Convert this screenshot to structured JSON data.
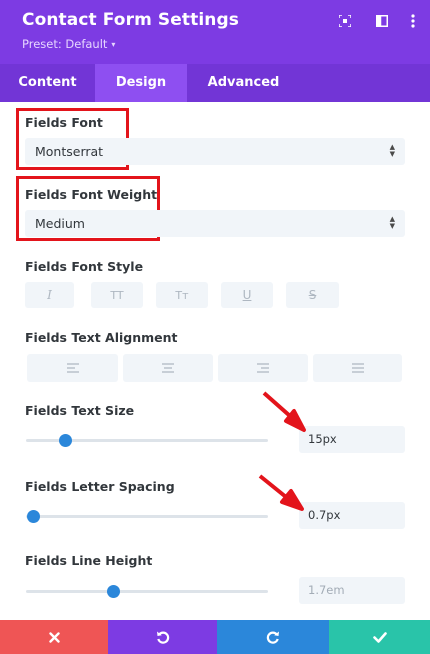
{
  "header": {
    "title": "Contact Form Settings",
    "preset": "Preset: Default",
    "icons": [
      "focus-icon",
      "split-layout-icon",
      "more-vertical-icon"
    ]
  },
  "tabs": [
    {
      "label": "Content",
      "active": false
    },
    {
      "label": "Design",
      "active": true
    },
    {
      "label": "Advanced",
      "active": false
    }
  ],
  "fields_font": {
    "label": "Fields Font",
    "value": "Montserrat"
  },
  "fields_font_weight": {
    "label": "Fields Font Weight",
    "value": "Medium"
  },
  "fields_font_style": {
    "label": "Fields Font Style",
    "options": [
      {
        "glyph": "I",
        "icon": "italic-icon"
      },
      {
        "glyph": "TT",
        "icon": "uppercase-icon"
      },
      {
        "glyph": "Tт",
        "icon": "capitalize-icon"
      },
      {
        "glyph": "U",
        "icon": "underline-icon"
      },
      {
        "glyph": "S",
        "icon": "strikethrough-icon"
      }
    ]
  },
  "fields_text_alignment": {
    "label": "Fields Text Alignment",
    "options": [
      "align-left-icon",
      "align-center-icon",
      "align-right-icon",
      "align-justify-icon"
    ]
  },
  "fields_text_size": {
    "label": "Fields Text Size",
    "value": "15px",
    "slider_fraction": 0.16
  },
  "fields_letter_spacing": {
    "label": "Fields Letter Spacing",
    "value": "0.7px",
    "slider_fraction": 0.03
  },
  "fields_line_height": {
    "label": "Fields Line Height",
    "value": "1.7em",
    "slider_fraction": 0.36
  },
  "footer": {
    "buttons": [
      "close-icon",
      "undo-icon",
      "redo-icon",
      "check-icon"
    ]
  },
  "colors": {
    "header": "#7d3be3",
    "tabs": "#7235d6",
    "active_tab": "#8e4ff1",
    "highlight": "#e3141b",
    "slider": "#2b87da",
    "cancel": "#ef5555",
    "save": "#29c4a9"
  }
}
